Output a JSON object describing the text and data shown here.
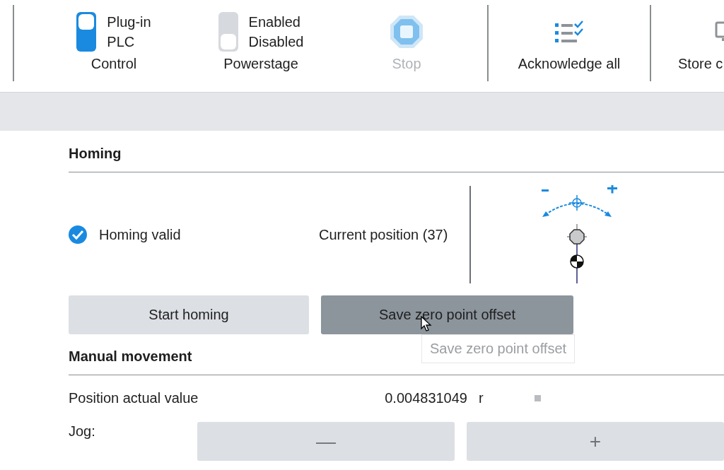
{
  "toolbar": {
    "groups": [
      {
        "kind": "toggle",
        "label": "Control",
        "on": true,
        "options": [
          "Plug-in",
          "PLC"
        ]
      },
      {
        "kind": "toggle",
        "label": "Powerstage",
        "on": false,
        "options": [
          "Enabled",
          "Disabled"
        ]
      },
      {
        "kind": "button",
        "label": "Stop",
        "disabled": true
      },
      {
        "kind": "button",
        "label": "Acknowledge all",
        "disabled": false
      },
      {
        "kind": "button",
        "label": "Store c",
        "disabled": false
      }
    ]
  },
  "homing": {
    "title": "Homing",
    "valid": {
      "label": "Homing valid",
      "checked": true
    },
    "position_label": "Current position (37)",
    "buttons": [
      {
        "label": "Start homing",
        "hovered": false
      },
      {
        "label": "Save zero point offset",
        "hovered": true
      }
    ],
    "tooltip": "Save zero point offset"
  },
  "manual": {
    "title": "Manual movement",
    "rows": [
      {
        "label": "Position actual value",
        "value": "0.004831049",
        "unit": "r"
      }
    ],
    "jog": {
      "label": "Jog:",
      "buttons": [
        "—",
        "+"
      ]
    }
  }
}
